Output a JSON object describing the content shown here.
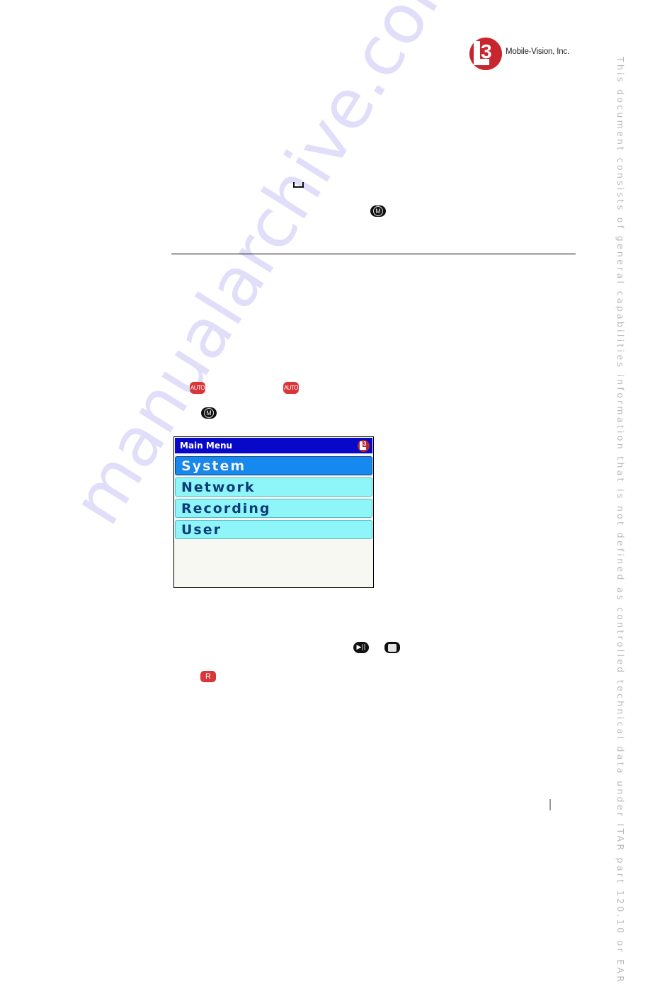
{
  "header": {
    "logo_mark": "3",
    "company": "Mobile-Vision, Inc."
  },
  "side_notice": "This document consists of general capabilities information that is not defined as controlled technical data under ITAR part 120.10 or EAR",
  "watermark": "manualarchive.com",
  "icons": {
    "menu_button_label": "M",
    "auto_button_label": "AUTO",
    "record_button_label": "R",
    "play_pause_glyph": "▶||"
  },
  "main_menu": {
    "title": "Main Menu",
    "logo_mark": "3",
    "items": [
      {
        "label": "System",
        "selected": true
      },
      {
        "label": "Network",
        "selected": false
      },
      {
        "label": "Recording",
        "selected": false
      },
      {
        "label": "User",
        "selected": false
      }
    ]
  },
  "colors": {
    "title_bar": "#0808c8",
    "selected_item": "#1589ee",
    "item": "#8ef5f8",
    "brand_red": "#c8262e"
  }
}
